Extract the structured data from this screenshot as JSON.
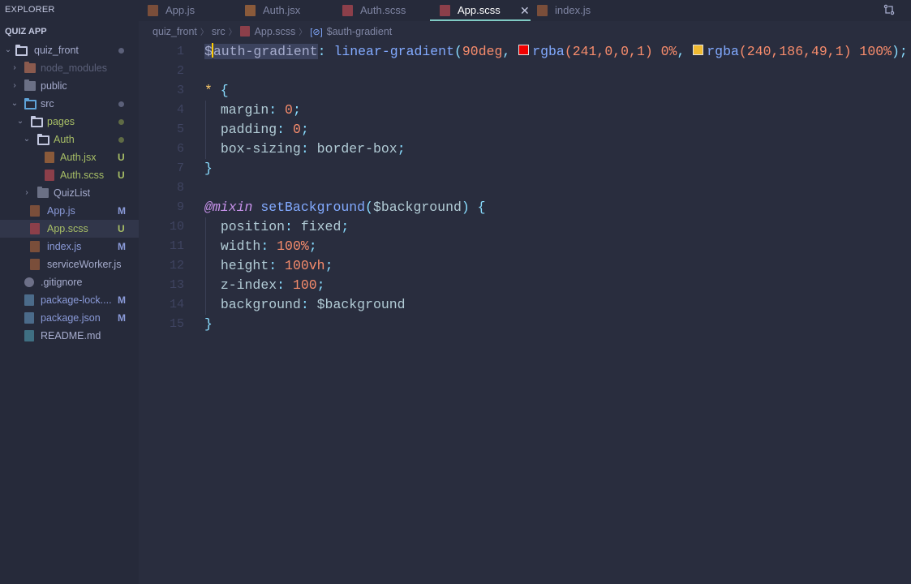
{
  "sidebar": {
    "title": "EXPLORER",
    "section": "QUIZ APP",
    "items": [
      {
        "label": "quiz_front",
        "status": "dot",
        "statusColor": "#5b6079"
      },
      {
        "label": "node_modules",
        "status": ""
      },
      {
        "label": "public",
        "status": ""
      },
      {
        "label": "src",
        "status": "dot",
        "statusColor": "#5b6079"
      },
      {
        "label": "pages",
        "status": "dot",
        "statusColor": "#5f6b45"
      },
      {
        "label": "Auth",
        "status": "dot",
        "statusColor": "#5f6b45"
      },
      {
        "label": "Auth.jsx",
        "status": "U"
      },
      {
        "label": "Auth.scss",
        "status": "U"
      },
      {
        "label": "QuizList",
        "status": ""
      },
      {
        "label": "App.js",
        "status": "M"
      },
      {
        "label": "App.scss",
        "status": "U"
      },
      {
        "label": "index.js",
        "status": "M"
      },
      {
        "label": "serviceWorker.js",
        "status": ""
      },
      {
        "label": ".gitignore",
        "status": ""
      },
      {
        "label": "package-lock....",
        "status": "M"
      },
      {
        "label": "package.json",
        "status": "M"
      },
      {
        "label": "README.md",
        "status": ""
      }
    ]
  },
  "tabs": [
    {
      "label": "App.js"
    },
    {
      "label": "Auth.jsx"
    },
    {
      "label": "Auth.scss"
    },
    {
      "label": "App.scss",
      "close": "✕"
    },
    {
      "label": "index.js"
    }
  ],
  "breadcrumb": {
    "parts": [
      "quiz_front",
      "src",
      "App.scss",
      "$auth-gradient"
    ]
  },
  "editor": {
    "line_numbers": [
      "1",
      "2",
      "3",
      "4",
      "5",
      "6",
      "7",
      "8",
      "9",
      "10",
      "11",
      "12",
      "13",
      "14",
      "15"
    ],
    "line1": {
      "dollar": "$",
      "varname": "auth-gradient",
      "colon": ": ",
      "func": "linear-gradient",
      "open": "(",
      "deg": "90deg",
      "comma1": ", ",
      "rgba1": "rgba",
      "rgba1_args": "(241,0,0,1)",
      "pct1": " 0%",
      "comma2": ", ",
      "rgba2": "rgba",
      "rgba2_args": "(240,186,49,1)",
      "pct2": " 100%",
      "close": ");",
      "swatch1": "#f10000",
      "swatch2": "#f0ba31"
    },
    "line3": {
      "selector": "*",
      "brace": " {"
    },
    "line4": {
      "prop": "margin",
      "colon": ": ",
      "val": "0",
      "semi": ";"
    },
    "line5": {
      "prop": "padding",
      "colon": ": ",
      "val": "0",
      "semi": ";"
    },
    "line6": {
      "prop": "box-sizing",
      "colon": ": ",
      "val": "border-box",
      "semi": ";"
    },
    "line7": {
      "brace": "}"
    },
    "line9": {
      "kw": "@mixin",
      "name": " setBackground",
      "open": "(",
      "param": "$background",
      "close": ")",
      "brace": " {"
    },
    "line10": {
      "prop": "position",
      "colon": ": ",
      "val": "fixed",
      "semi": ";"
    },
    "line11": {
      "prop": "width",
      "colon": ": ",
      "val": "100%",
      "semi": ";"
    },
    "line12": {
      "prop": "height",
      "colon": ": ",
      "val": "100vh",
      "semi": ";"
    },
    "line13": {
      "prop": "z-index",
      "colon": ": ",
      "val": "100",
      "semi": ";"
    },
    "line14": {
      "prop": "background",
      "colon": ": ",
      "val": "$background"
    },
    "line15": {
      "brace": "}"
    }
  },
  "colors": {
    "accent": "#80cbc4",
    "background": "#292d3e",
    "modified": "#8a9ad8",
    "untracked": "#a8bf66"
  }
}
